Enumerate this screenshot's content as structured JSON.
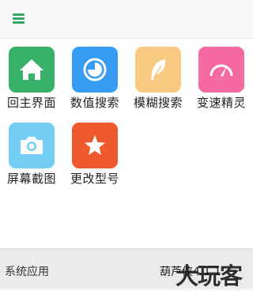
{
  "header": {
    "menu_icon": "hamburger-menu-icon",
    "accent": "#37a564"
  },
  "apps": [
    {
      "label": "回主界面",
      "icon": "home-icon",
      "color": "#38b26a"
    },
    {
      "label": "数值搜索",
      "icon": "pie-chart-icon",
      "color": "#369cf2"
    },
    {
      "label": "模糊搜索",
      "icon": "feather-icon",
      "color": "#f7c981"
    },
    {
      "label": "变速精灵",
      "icon": "speedometer-icon",
      "color": "#f56aa0"
    },
    {
      "label": "屏幕截图",
      "icon": "camera-icon",
      "color": "#74cdf5"
    },
    {
      "label": "更改型号",
      "icon": "star-icon",
      "color": "#ee5a2d"
    }
  ],
  "footer": {
    "left_label": "系统应用",
    "right_label": "葫芦侠4.1.1",
    "watermark": "大玩客"
  }
}
